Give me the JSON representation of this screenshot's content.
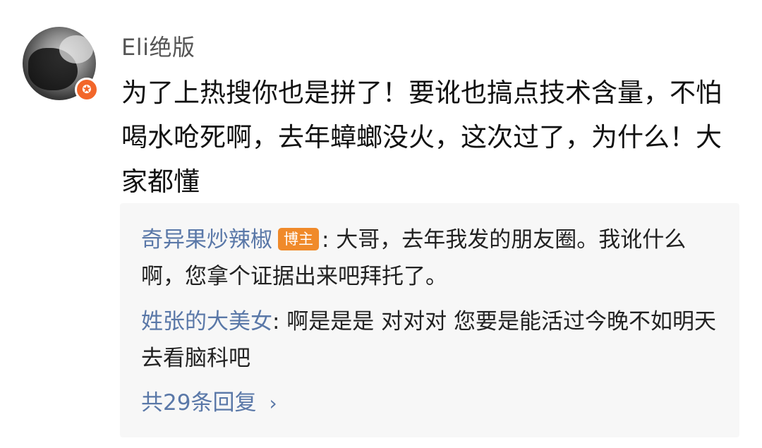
{
  "post": {
    "username": "Eli绝版",
    "avatar_icon": "user-avatar",
    "badge_icon": "vip-star-icon",
    "badge_symbol": "✪",
    "comment_text": "为了上热搜你也是拼了！要讹也搞点技术含量，不怕喝水呛死啊，去年蟑螂没火，这次过了，为什么！大家都懂"
  },
  "replies": [
    {
      "author": "奇异果炒辣椒",
      "badge": "博主",
      "text": ": 大哥，去年我发的朋友圈。我讹什么啊，您拿个证据出来吧拜托了。"
    },
    {
      "author": "姓张的大美女",
      "text": ": 啊是是是 对对对 您要是能活过今晚不如明天去看脑科吧"
    }
  ],
  "more_replies": {
    "label": "共29条回复",
    "icon": "chevron-right-icon",
    "symbol": "›"
  },
  "colors": {
    "link_blue": "#5a78a8",
    "badge_orange": "#f08a2a",
    "vip_orange": "#f2662a",
    "reply_bg": "#f7f7f7"
  }
}
